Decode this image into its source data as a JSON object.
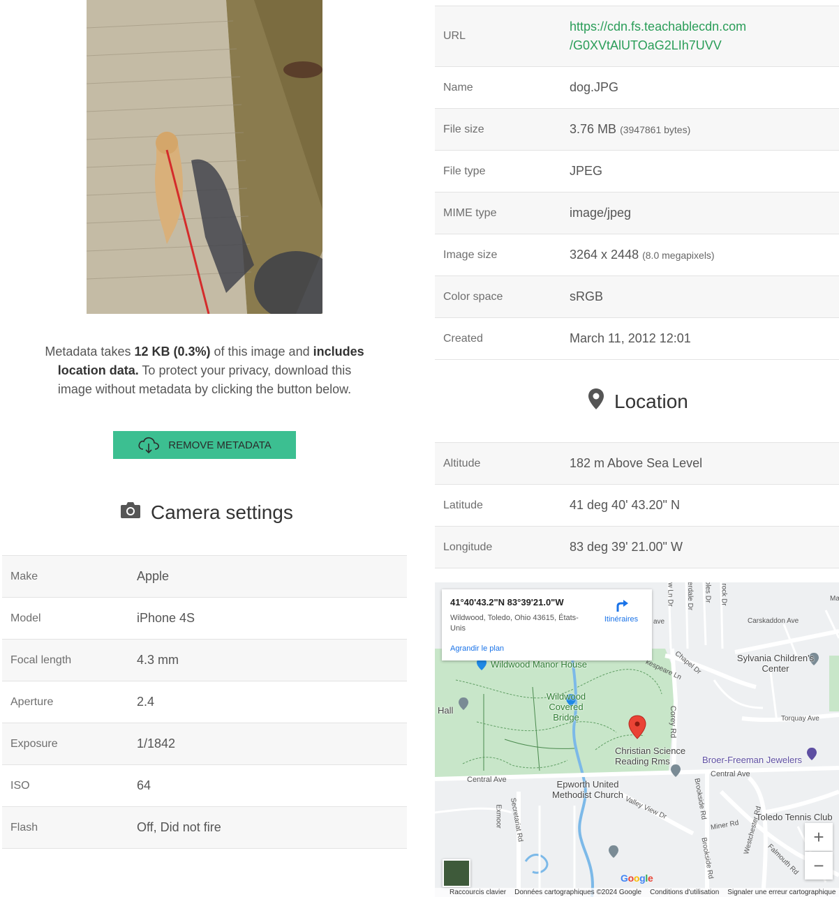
{
  "metadata_notice": {
    "prefix": "Metadata takes ",
    "size": "12 KB (0.3%)",
    "middle": " of this image and ",
    "location": "includes location data.",
    "suffix": " To protect your privacy, download this image without metadata by clicking the button below."
  },
  "remove_button_label": "REMOVE METADATA",
  "camera": {
    "title": "Camera settings",
    "rows": [
      {
        "key": "Make",
        "value": "Apple"
      },
      {
        "key": "Model",
        "value": "iPhone 4S"
      },
      {
        "key": "Focal length",
        "value": "4.3 mm"
      },
      {
        "key": "Aperture",
        "value": "2.4"
      },
      {
        "key": "Exposure",
        "value": "1/1842"
      },
      {
        "key": "ISO",
        "value": "64"
      },
      {
        "key": "Flash",
        "value": "Off, Did not fire"
      }
    ]
  },
  "file": {
    "url_key": "URL",
    "url_line1": "https://cdn.fs.teachablecdn.com",
    "url_line2": "/G0XVtAlUTOaG2LIh7UVV",
    "name_key": "Name",
    "name_value": "dog.JPG",
    "size_key": "File size",
    "size_value": "3.76 MB",
    "size_detail": "(3947861 bytes)",
    "type_key": "File type",
    "type_value": "JPEG",
    "mime_key": "MIME type",
    "mime_value": "image/jpeg",
    "imgsize_key": "Image size",
    "imgsize_value": "3264 x 2448",
    "imgsize_detail": "(8.0 megapixels)",
    "color_key": "Color space",
    "color_value": "sRGB",
    "created_key": "Created",
    "created_value": "March 11, 2012 12:01"
  },
  "location": {
    "title": "Location",
    "rows": [
      {
        "key": "Altitude",
        "value": "182 m Above Sea Level"
      },
      {
        "key": "Latitude",
        "value": "41 deg 40' 43.20\" N"
      },
      {
        "key": "Longitude",
        "value": "83 deg 39' 21.00\" W"
      }
    ]
  },
  "map": {
    "card": {
      "coords": "41°40'43.2\"N 83°39'21.0\"W",
      "address": "Wildwood, Toledo, Ohio 43615, États-Unis",
      "directions": "Itinéraires",
      "enlarge": "Agrandir le plan"
    },
    "pois": {
      "manor": "Wildwood Manor House",
      "bridge": "Wildwood Covered Bridge",
      "hall": "Hall",
      "christian": "Christian Science Reading Rms",
      "broer": "Broer-Freeman Jewelers",
      "epworth": "Epworth United Methodist Church",
      "sylvania": "Sylvania Children's Center",
      "tennis": "Toledo Tennis Club"
    },
    "streets": {
      "central_w": "Central Ave",
      "central_e": "Central Ave",
      "corey": "Corey Rd",
      "carskaddon": "Carskaddon Ave",
      "torquay": "Torquay Ave",
      "chapel": "Chapel Dr",
      "shakespeare": "kespeare Ln",
      "valley": "Valley View Dr",
      "miner": "Miner Rd",
      "brookside": "Brookside Rd",
      "brookside2": "Brookside Rd",
      "westchester": "Westchester Rd",
      "falmouth": "Falmouth Rd",
      "secretariat": "Secretariat Rd",
      "exmoor": "Exmoor",
      "ln": "w Ln Dr",
      "erdale": "erdale Dr",
      "oles": "oles Dr",
      "rock": "rock Dr",
      "ave": "ave",
      "ma": "Ma"
    },
    "zoom_in": "+",
    "zoom_out": "−",
    "google": "Google",
    "attrib": {
      "shortcuts": "Raccourcis clavier",
      "data": "Données cartographiques ©2024 Google",
      "terms": "Conditions d'utilisation",
      "report": "Signaler une erreur cartographique"
    }
  }
}
